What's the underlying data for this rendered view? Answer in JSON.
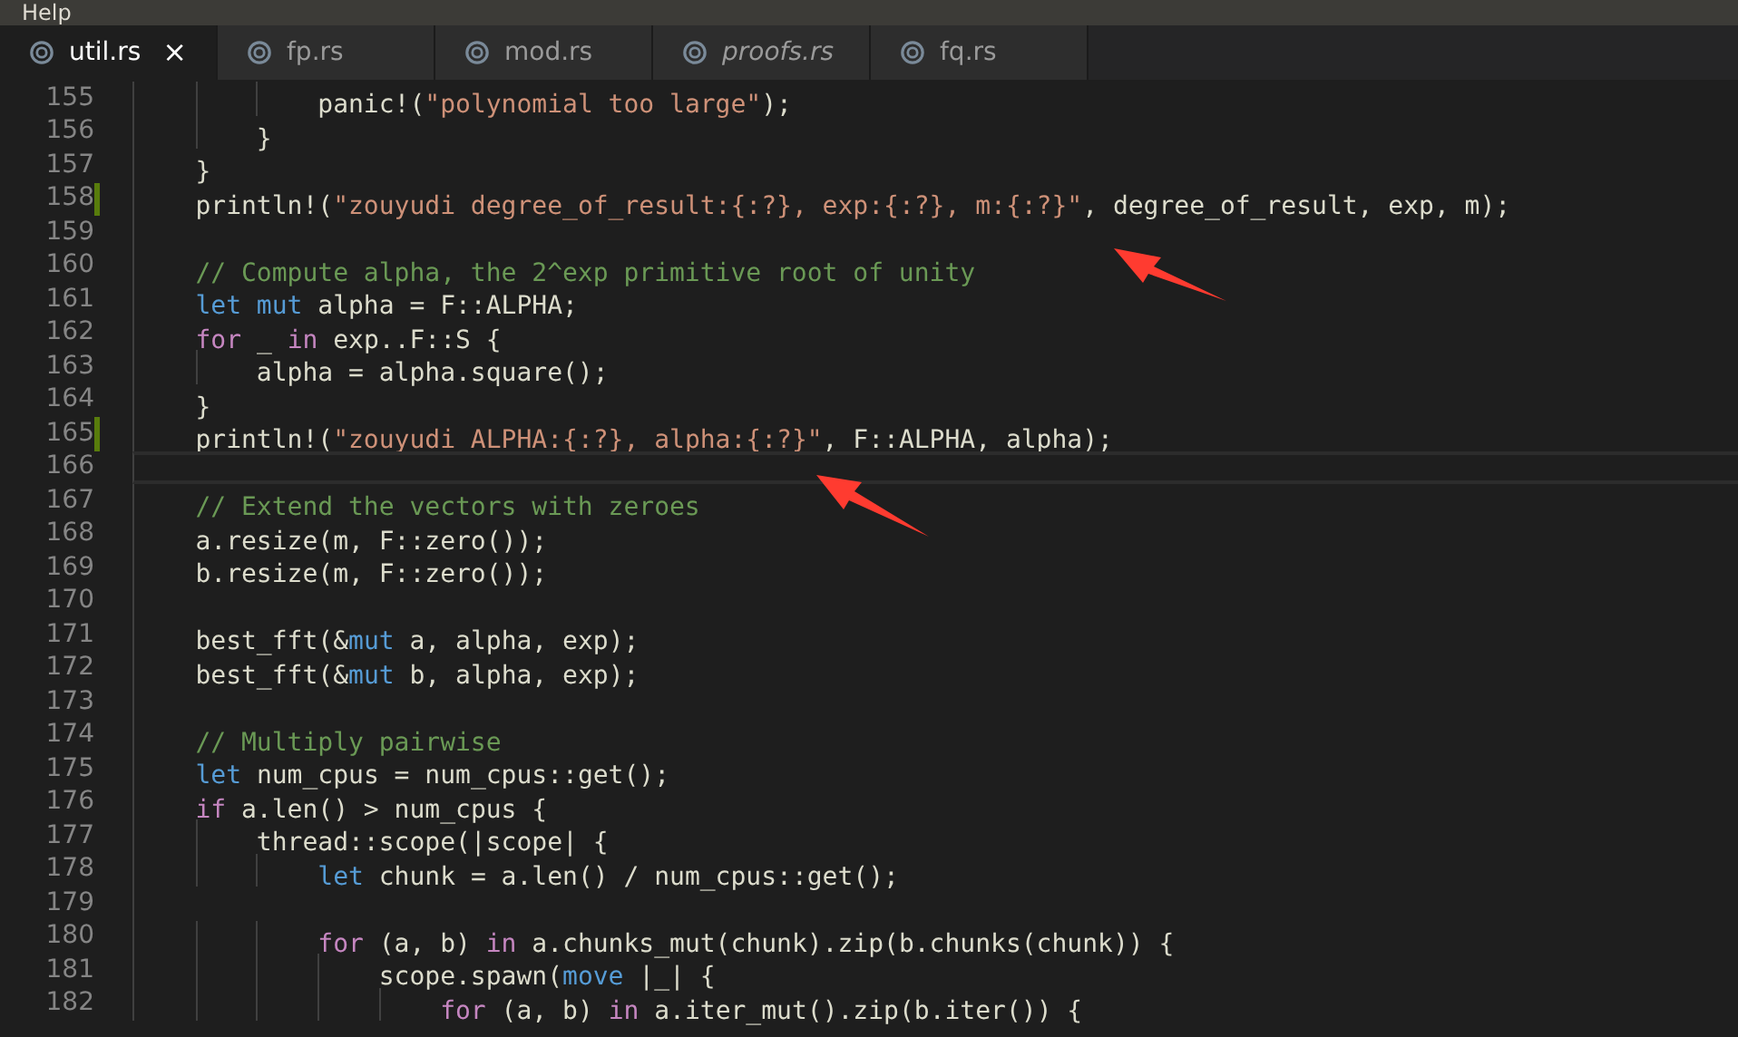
{
  "menu": {
    "label": "Help"
  },
  "tabs": [
    {
      "label": "util.rs",
      "selected": true,
      "preview": false,
      "closable": true,
      "close": "×"
    },
    {
      "label": "fp.rs",
      "selected": false,
      "preview": false,
      "closable": false
    },
    {
      "label": "mod.rs",
      "selected": false,
      "preview": false,
      "closable": false
    },
    {
      "label": "proofs.rs",
      "selected": false,
      "preview": true,
      "closable": false
    },
    {
      "label": "fq.rs",
      "selected": false,
      "preview": false,
      "closable": false
    }
  ],
  "editor": {
    "lines": [
      {
        "number": "155",
        "modified": false,
        "current": false,
        "tokens": [
          {
            "kind": "plain",
            "text": "            panic!("
          },
          {
            "kind": "string",
            "text": "\"polynomial too large\""
          },
          {
            "kind": "plain",
            "text": ");"
          }
        ]
      },
      {
        "number": "156",
        "modified": false,
        "current": false,
        "tokens": [
          {
            "kind": "plain",
            "text": "        }"
          }
        ]
      },
      {
        "number": "157",
        "modified": false,
        "current": false,
        "tokens": [
          {
            "kind": "plain",
            "text": "    }"
          }
        ]
      },
      {
        "number": "158",
        "modified": true,
        "current": false,
        "tokens": [
          {
            "kind": "plain",
            "text": "    println!("
          },
          {
            "kind": "string",
            "text": "\"zouyudi degree_of_result:{:?}, exp:{:?}, m:{:?}\""
          },
          {
            "kind": "plain",
            "text": ", degree_of_result, exp, m);"
          }
        ]
      },
      {
        "number": "159",
        "modified": false,
        "current": false
      },
      {
        "number": "160",
        "modified": false,
        "current": false,
        "tokens": [
          {
            "kind": "comment",
            "text": "    // Compute alpha, the 2^exp primitive root of unity"
          }
        ]
      },
      {
        "number": "161",
        "modified": false,
        "current": false,
        "tokens": [
          {
            "kind": "keyword",
            "text": "    let mut"
          },
          {
            "kind": "plain",
            "text": " alpha = F::ALPHA;"
          }
        ]
      },
      {
        "number": "162",
        "modified": false,
        "current": false,
        "tokens": [
          {
            "kind": "control",
            "text": "    for"
          },
          {
            "kind": "plain",
            "text": " _ "
          },
          {
            "kind": "control",
            "text": "in"
          },
          {
            "kind": "plain",
            "text": " exp..F::S {"
          }
        ]
      },
      {
        "number": "163",
        "modified": false,
        "current": false,
        "tokens": [
          {
            "kind": "plain",
            "text": "        alpha = alpha.square();"
          }
        ]
      },
      {
        "number": "164",
        "modified": false,
        "current": false,
        "tokens": [
          {
            "kind": "plain",
            "text": "    }"
          }
        ]
      },
      {
        "number": "165",
        "modified": true,
        "current": false,
        "tokens": [
          {
            "kind": "plain",
            "text": "    println!("
          },
          {
            "kind": "string",
            "text": "\"zouyudi ALPHA:{:?}, alpha:{:?}\""
          },
          {
            "kind": "plain",
            "text": ", F::ALPHA, alpha);"
          }
        ]
      },
      {
        "number": "166",
        "modified": false,
        "current": true
      },
      {
        "number": "167",
        "modified": false,
        "current": false,
        "tokens": [
          {
            "kind": "comment",
            "text": "    // Extend the vectors with zeroes"
          }
        ]
      },
      {
        "number": "168",
        "modified": false,
        "current": false,
        "tokens": [
          {
            "kind": "plain",
            "text": "    a.resize(m, F::zero());"
          }
        ]
      },
      {
        "number": "169",
        "modified": false,
        "current": false,
        "tokens": [
          {
            "kind": "plain",
            "text": "    b.resize(m, F::zero());"
          }
        ]
      },
      {
        "number": "170",
        "modified": false,
        "current": false
      },
      {
        "number": "171",
        "modified": false,
        "current": false,
        "tokens": [
          {
            "kind": "plain",
            "text": "    best_fft(&"
          },
          {
            "kind": "keyword",
            "text": "mut"
          },
          {
            "kind": "plain",
            "text": " a, alpha, exp);"
          }
        ]
      },
      {
        "number": "172",
        "modified": false,
        "current": false,
        "tokens": [
          {
            "kind": "plain",
            "text": "    best_fft(&"
          },
          {
            "kind": "keyword",
            "text": "mut"
          },
          {
            "kind": "plain",
            "text": " b, alpha, exp);"
          }
        ]
      },
      {
        "number": "173",
        "modified": false,
        "current": false
      },
      {
        "number": "174",
        "modified": false,
        "current": false,
        "tokens": [
          {
            "kind": "comment",
            "text": "    // Multiply pairwise"
          }
        ]
      },
      {
        "number": "175",
        "modified": false,
        "current": false,
        "tokens": [
          {
            "kind": "keyword",
            "text": "    let"
          },
          {
            "kind": "plain",
            "text": " num_cpus = num_cpus::get();"
          }
        ]
      },
      {
        "number": "176",
        "modified": false,
        "current": false,
        "tokens": [
          {
            "kind": "control",
            "text": "    if"
          },
          {
            "kind": "plain",
            "text": " a.len() > num_cpus {"
          }
        ]
      },
      {
        "number": "177",
        "modified": false,
        "current": false,
        "tokens": [
          {
            "kind": "plain",
            "text": "        thread::scope(|scope| {"
          }
        ]
      },
      {
        "number": "178",
        "modified": false,
        "current": false,
        "tokens": [
          {
            "kind": "keyword",
            "text": "            let"
          },
          {
            "kind": "plain",
            "text": " chunk = a.len() / num_cpus::get();"
          }
        ]
      },
      {
        "number": "179",
        "modified": false,
        "current": false
      },
      {
        "number": "180",
        "modified": false,
        "current": false,
        "tokens": [
          {
            "kind": "control",
            "text": "            for"
          },
          {
            "kind": "plain",
            "text": " (a, b) "
          },
          {
            "kind": "control",
            "text": "in"
          },
          {
            "kind": "plain",
            "text": " a.chunks_mut(chunk).zip(b.chunks(chunk)) {"
          }
        ]
      },
      {
        "number": "181",
        "modified": false,
        "current": false,
        "tokens": [
          {
            "kind": "plain",
            "text": "                scope.spawn("
          },
          {
            "kind": "keyword",
            "text": "move"
          },
          {
            "kind": "plain",
            "text": " |_| {"
          }
        ]
      },
      {
        "number": "182",
        "modified": false,
        "current": false,
        "tokens": [
          {
            "kind": "control",
            "text": "                    for"
          },
          {
            "kind": "plain",
            "text": " (a, b) "
          },
          {
            "kind": "control",
            "text": "in"
          },
          {
            "kind": "plain",
            "text": " a.iter_mut().zip(b.iter()) {"
          }
        ]
      }
    ]
  }
}
